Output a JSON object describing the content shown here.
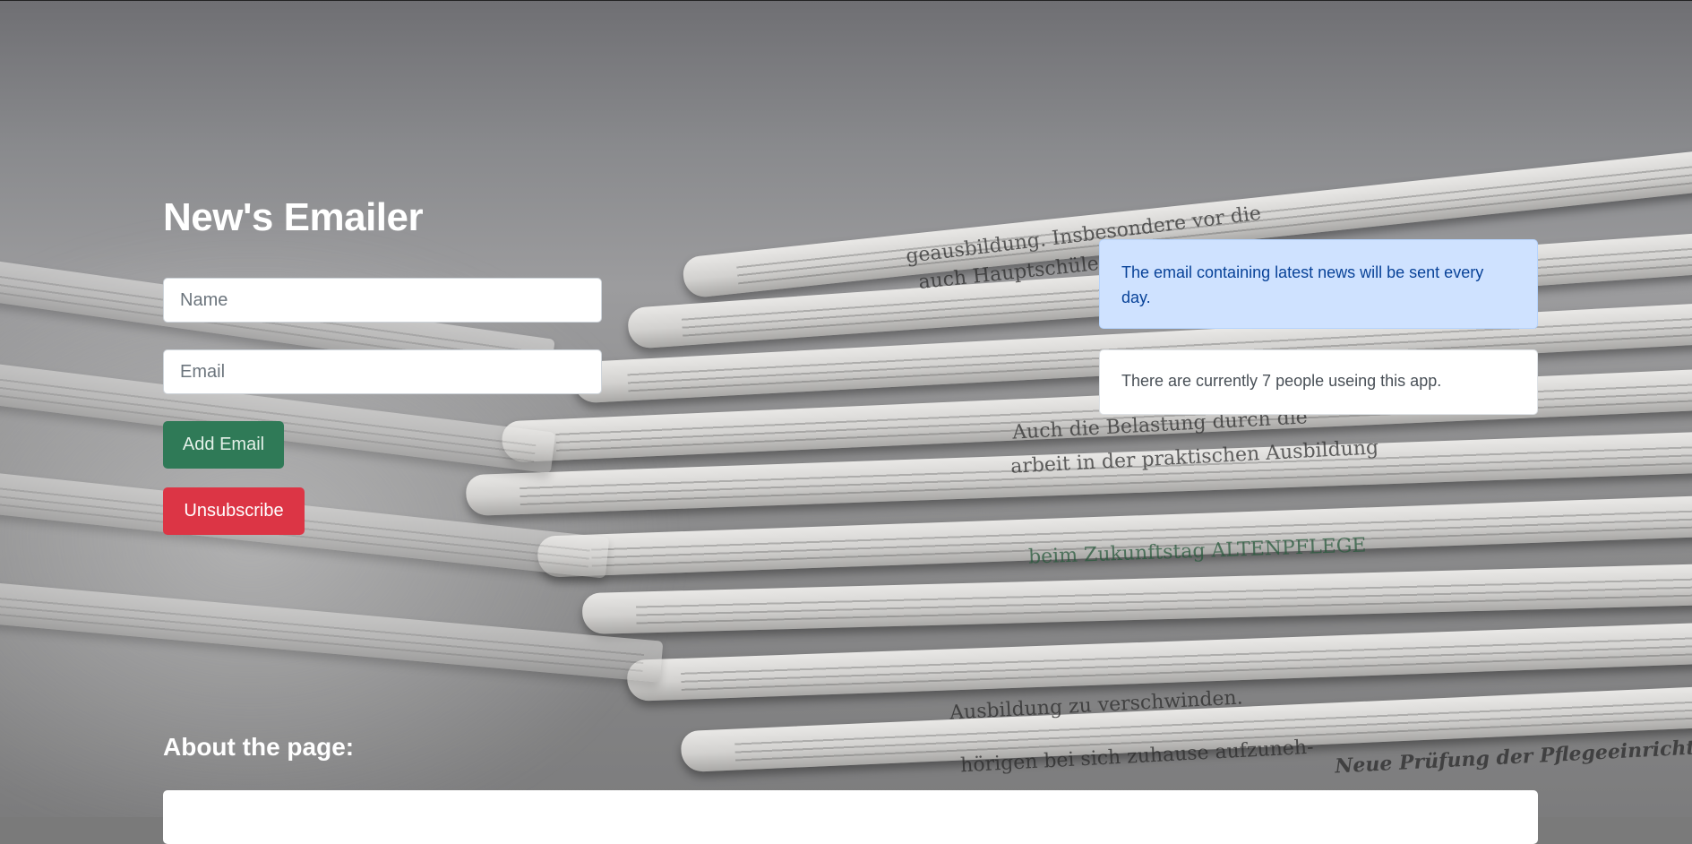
{
  "header": {
    "title": "New's Emailer"
  },
  "form": {
    "name_placeholder": "Name",
    "email_placeholder": "Email",
    "add_label": "Add Email",
    "unsubscribe_label": "Unsubscribe"
  },
  "info": {
    "schedule_text": "The email containing latest news will be sent every day.",
    "users_text": "There are currently 7 people useing this app."
  },
  "about": {
    "heading": "About the page:"
  },
  "colors": {
    "add_button": "#2f7a57",
    "unsubscribe_button": "#dc3545",
    "info_bg": "#cfe2ff"
  }
}
